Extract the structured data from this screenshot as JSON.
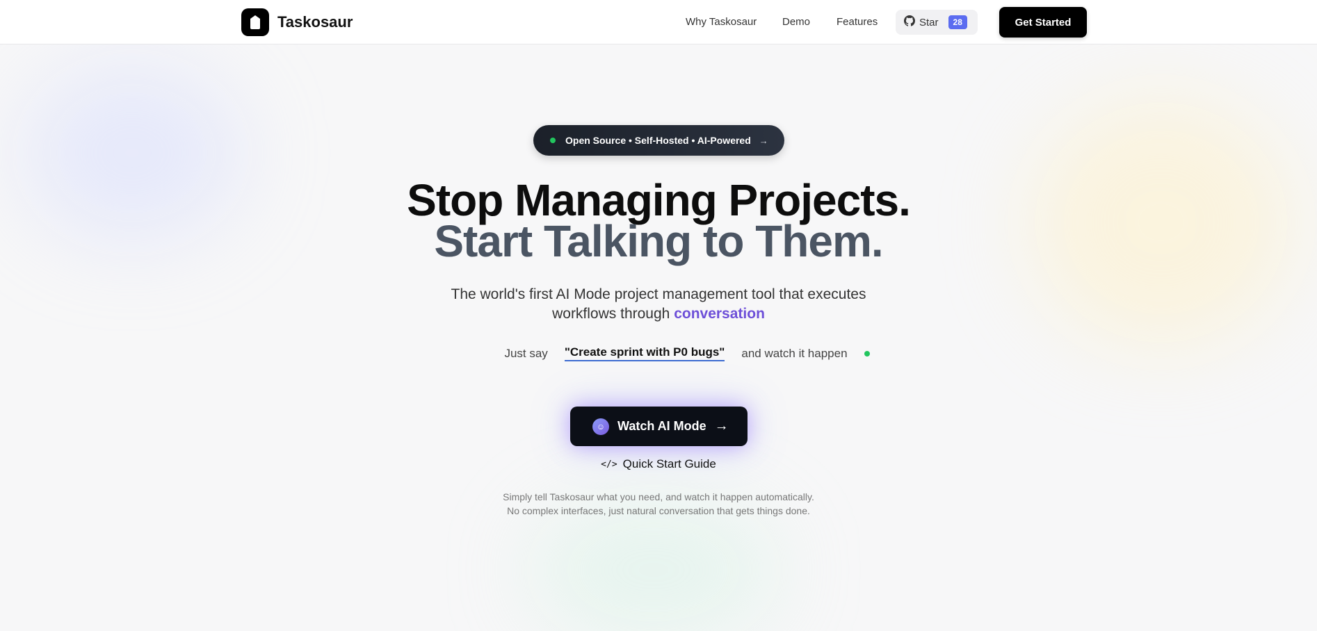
{
  "header": {
    "brand": "Taskosaur",
    "logo_icon": "taskosaur-logo-icon",
    "nav": {
      "why": "Why Taskosaur",
      "demo": "Demo",
      "features": "Features"
    },
    "star": {
      "icon": "github-icon",
      "label": "Star",
      "count": "28"
    },
    "cta": "Get Started"
  },
  "hero": {
    "badge": {
      "text": "Open Source • Self-Hosted • AI-Powered",
      "arrow": "→"
    },
    "title_line1": "Stop Managing Projects.",
    "title_line2": "Start Talking to Them.",
    "subtitle_line1": "The world's first AI Mode project management tool that executes",
    "subtitle_line2_prefix": "workflows through",
    "subtitle_highlight": "conversation",
    "just_say": "Just say",
    "example_quote": "\"Create sprint with P0 bugs\"",
    "watch_happen": "and watch it happen",
    "watch_button": "Watch AI Mode",
    "watch_arrow": "→",
    "quick_start": "Quick Start Guide",
    "description": "Simply tell Taskosaur what you need, and watch it happen automatically. No complex interfaces, just natural conversation that gets things done."
  },
  "colors": {
    "accent": "#6d4fd8",
    "star_badge": "#5b6cf0",
    "status_dot": "#22c55e"
  }
}
